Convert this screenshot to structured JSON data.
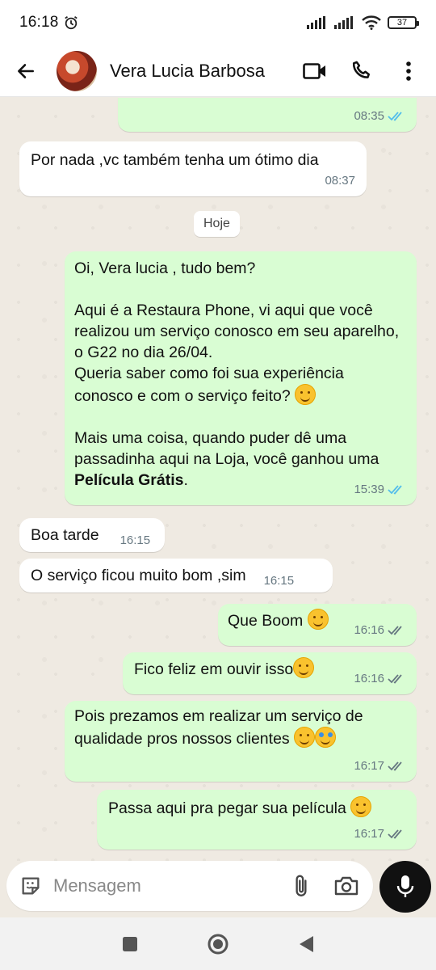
{
  "status_bar": {
    "time": "16:18",
    "battery": "37"
  },
  "header": {
    "contact_name": "Vera Lucia Barbosa"
  },
  "chat": {
    "date_chip": "Hoje",
    "messages": [
      {
        "dir": "out",
        "text": "",
        "time": "08:35",
        "ticks": "read"
      },
      {
        "dir": "in",
        "text": "Por nada ,vc também tenha um ótimo dia",
        "time": "08:37"
      },
      {
        "dir": "out",
        "text_1": "Oi, Vera lucia , tudo bem?\n\nAqui é a Restaura Phone, vi aqui que você realizou um serviço conosco em seu aparelho, o G22 no dia 26/04.\nQueria saber como foi sua experiência conosco e com o serviço feito? ",
        "text_2": "\n\nMais uma coisa, quando puder dê uma passadinha aqui na Loja, você ganhou uma ",
        "bold": "Película Grátis",
        "text_3": ".",
        "emoji": "smiling-face-emoji",
        "time": "15:39",
        "ticks": "read"
      },
      {
        "dir": "in",
        "text": "Boa tarde",
        "time": "16:15"
      },
      {
        "dir": "in",
        "text": "O serviço ficou muito bom ,sim",
        "time": "16:15"
      },
      {
        "dir": "out",
        "text": "Que Boom ",
        "emoji": "smiling-face-emoji",
        "time": "16:16",
        "ticks": "delivered"
      },
      {
        "dir": "out",
        "text": "Fico feliz em ouvir isso",
        "emoji": "smiling-face-emoji",
        "time": "16:16",
        "ticks": "delivered"
      },
      {
        "dir": "out",
        "text": "Pois prezamos em realizar um serviço de qualidade pros nossos clientes ",
        "emoji": "smiling-face-emoji",
        "emoji2": "star-struck-emoji",
        "time": "16:17",
        "ticks": "delivered"
      },
      {
        "dir": "out",
        "text": "Passa aqui pra pegar sua película ",
        "emoji": "smiling-face-emoji",
        "time": "16:17",
        "ticks": "delivered"
      }
    ]
  },
  "composer": {
    "placeholder": "Mensagem"
  },
  "colors": {
    "outgoing_bubble": "#d9fdd3",
    "incoming_bubble": "#ffffff",
    "read_tick": "#53bdeb",
    "delivered_tick": "#667781",
    "chat_bg": "#efeae2"
  }
}
